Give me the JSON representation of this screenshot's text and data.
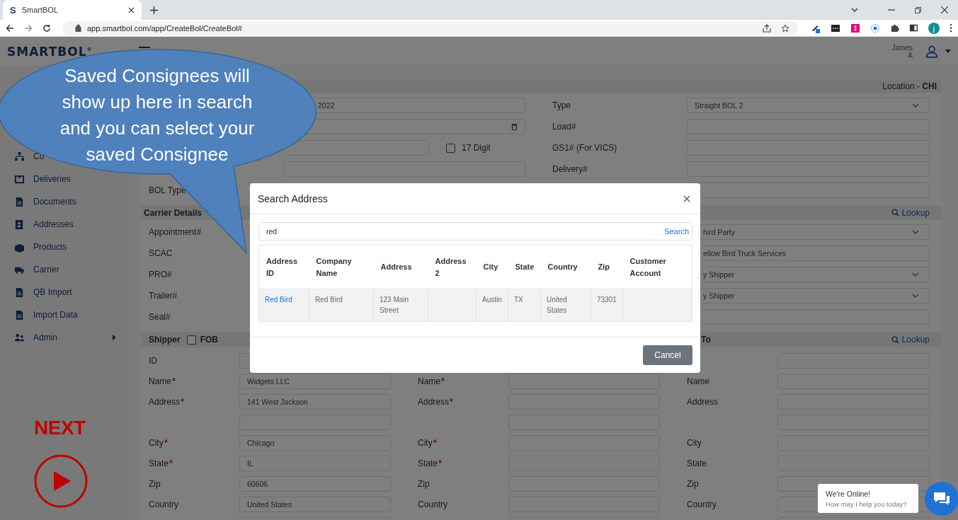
{
  "browser": {
    "tab_icon": "S",
    "tab_title": "SmartBOL",
    "url": "app.smartbol.com/app/CreateBol/CreateBol#",
    "profile_initial": "j"
  },
  "header": {
    "logo": "SMARTBOL$^{®}$",
    "user_name": "James",
    "user_initial": "A"
  },
  "sidebar": {
    "items": [
      {
        "label": "Co",
        "has_submenu": false
      },
      {
        "label": "Deliveries",
        "has_submenu": false
      },
      {
        "label": "Documents",
        "has_submenu": false
      },
      {
        "label": "Addresses",
        "has_submenu": false
      },
      {
        "label": "Products",
        "has_submenu": false
      },
      {
        "label": "Carrier",
        "has_submenu": false
      },
      {
        "label": "QB Import",
        "has_submenu": false
      },
      {
        "label": "Import Data",
        "has_submenu": false
      },
      {
        "label": "Admin",
        "has_submenu": true
      }
    ]
  },
  "location": "Location - **CHI**",
  "top_rows": [
    {
      "left": {
        "kind": "field",
        "value": "2022"
      },
      "right": {
        "label": "Type",
        "kind": "select",
        "value": "Straight BOL 2"
      }
    },
    {
      "left": {
        "kind": "date"
      },
      "right": {
        "label": "Load#",
        "kind": "field"
      }
    },
    {
      "left": {
        "kind": "short",
        "checkbox": {
          "label": "17 Digit",
          "checked": false
        }
      },
      "right": {
        "label": "GS1# (For VICS)",
        "kind": "field"
      }
    },
    {
      "left": {
        "kind": "field"
      },
      "right": {
        "label": "Delivery#",
        "kind": "field"
      }
    },
    {
      "left": {
        "label": "BOL Type"
      },
      "right": {
        "kind": "field"
      }
    }
  ],
  "carrier": {
    "title": "Carrier Details",
    "lookup": "Lookup"
  },
  "carrier_rows": [
    {
      "left": {
        "label": "Appointment#"
      },
      "right": {
        "kind": "select",
        "value": "hird Party"
      }
    },
    {
      "left": {
        "label": "SCAC"
      },
      "right": {
        "kind": "field",
        "value": "ellow Bird Truck Services"
      }
    },
    {
      "left": {
        "label": "PRO#"
      },
      "right": {
        "kind": "select",
        "value": "y Shipper"
      }
    },
    {
      "left": {
        "label": "Trailer#"
      },
      "right": {
        "kind": "select",
        "value": "y Shipper"
      }
    },
    {
      "left": {
        "label": "Seal#"
      },
      "right": {
        "kind": "field"
      }
    }
  ],
  "party_bar": {
    "title": "Shipper",
    "fob": {
      "label": "FOB",
      "checked": false
    },
    "column_3_title": "To",
    "lookup": "Lookup"
  },
  "party_rows": [
    {
      "cells": [
        {
          "kind": "labeled",
          "label": "ID",
          "required": false
        },
        {
          "kind": "hidden"
        },
        {
          "kind": "field"
        }
      ]
    },
    {
      "cells": [
        {
          "kind": "labeled",
          "label": "Name",
          "required": true,
          "value": "Widgets LLC"
        },
        {
          "kind": "labeled",
          "label": "Name",
          "required": true
        },
        {
          "kind": "labeled",
          "label": "Name",
          "required": false
        }
      ]
    },
    {
      "cells": [
        {
          "kind": "labeled",
          "label": "Address",
          "required": true,
          "value": "141 West Jackson"
        },
        {
          "kind": "labeled",
          "label": "Address",
          "required": true
        },
        {
          "kind": "labeled",
          "label": "Address",
          "required": false
        }
      ]
    },
    {
      "cells": [
        {
          "kind": "field"
        },
        {
          "kind": "field"
        },
        {
          "kind": "field"
        }
      ]
    },
    {
      "cells": [
        {
          "kind": "labeled",
          "label": "City",
          "required": true,
          "value": "Chicago"
        },
        {
          "kind": "labeled",
          "label": "City",
          "required": true
        },
        {
          "kind": "labeled",
          "label": "City",
          "required": false
        }
      ]
    },
    {
      "cells": [
        {
          "kind": "labeled",
          "label": "State",
          "required": true,
          "value": "IL"
        },
        {
          "kind": "labeled",
          "label": "State",
          "required": true
        },
        {
          "kind": "labeled",
          "label": "State",
          "required": false
        }
      ]
    },
    {
      "cells": [
        {
          "kind": "labeled",
          "label": "Zip",
          "required": false,
          "value": "60606"
        },
        {
          "kind": "labeled",
          "label": "Zip",
          "required": false
        },
        {
          "kind": "labeled",
          "label": "Zip",
          "required": false
        }
      ]
    },
    {
      "cells": [
        {
          "kind": "labeled",
          "label": "Country",
          "required": false,
          "value": "United States"
        },
        {
          "kind": "labeled",
          "label": "Country",
          "required": false
        },
        {
          "kind": "labeled",
          "label": "Country",
          "required": false
        }
      ]
    },
    {
      "cells": [
        {
          "kind": "field"
        },
        {
          "kind": "field"
        },
        {
          "kind": "field"
        }
      ]
    }
  ],
  "modal": {
    "title": "Search Address",
    "search_value": "red",
    "search_button": "Search",
    "columns": [
      "Address ID",
      "Company Name",
      "Address",
      "Address 2",
      "City",
      "State",
      "Country",
      "Zip",
      "Customer Account"
    ],
    "rows": [
      {
        "cells": [
          "Red Bird",
          "Red Bird",
          "123 Main Street",
          null,
          "Austin",
          "TX",
          "United States",
          "73301",
          null
        ]
      }
    ],
    "cancel": "Cancel"
  },
  "callout": "Saved Consignees will show up here in search and you can select your saved Consignee",
  "tutorial": {
    "next_label": "NEXT"
  },
  "chat": {
    "title": "We're Online!",
    "prompt": "How may I help you today?"
  }
}
